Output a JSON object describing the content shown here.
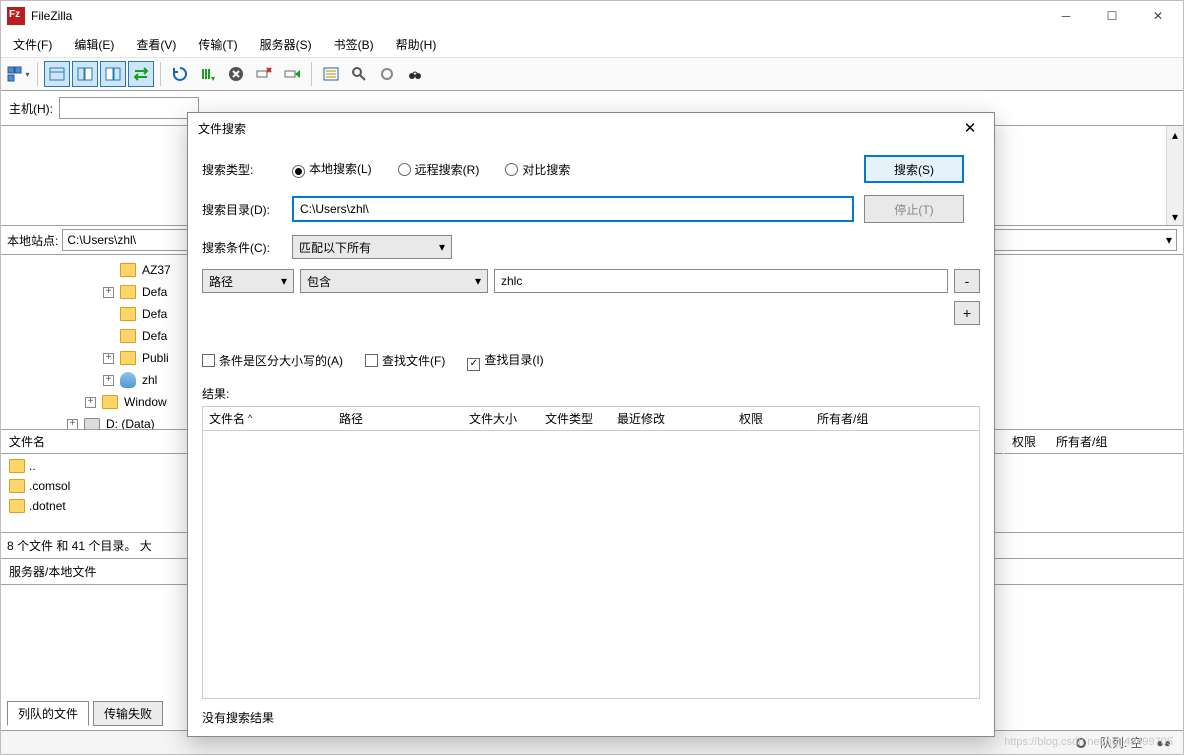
{
  "app": {
    "title": "FileZilla"
  },
  "menu": {
    "file": "文件(F)",
    "edit": "编辑(E)",
    "view": "查看(V)",
    "transfer": "传输(T)",
    "server": "服务器(S)",
    "bookmarks": "书签(B)",
    "help": "帮助(H)"
  },
  "hostbar": {
    "host_label": "主机(H):"
  },
  "local": {
    "site_label": "本地站点:",
    "path": "C:\\Users\\zhl\\",
    "tree": [
      "AZ37",
      "Defa",
      "Defa",
      "Defa",
      "Publi",
      "zhl",
      "Window",
      "D: (Data)"
    ]
  },
  "file_header": {
    "name": "文件名"
  },
  "files": [
    "..",
    ".comsol",
    ".dotnet"
  ],
  "status_line": "8 个文件 和 41 个目录。 大",
  "queue_head": "服务器/本地文件",
  "tabs": {
    "queued": "列队的文件",
    "failed": "传输失败"
  },
  "right_header": {
    "perm": "权限",
    "owner": "所有者/组"
  },
  "statusbar": {
    "queue": "队列: 空"
  },
  "watermark": "https://blog.csdn.net/qq_43499705",
  "dialog": {
    "title": "文件搜索",
    "type_label": "搜索类型:",
    "type_local": "本地搜索(L)",
    "type_remote": "远程搜索(R)",
    "type_compare": "对比搜索",
    "search_btn": "搜索(S)",
    "stop_btn": "停止(T)",
    "dir_label": "搜索目录(D):",
    "dir_value": "C:\\Users\\zhl\\",
    "cond_label": "搜索条件(C):",
    "cond_match": "匹配以下所有",
    "crit_path": "路径",
    "crit_contains": "包含",
    "crit_value": "zhlc",
    "chk_case": "条件是区分大小写的(A)",
    "chk_files": "查找文件(F)",
    "chk_dirs": "查找目录(I)",
    "results_label": "结果:",
    "cols": {
      "name": "文件名",
      "path": "路径",
      "size": "文件大小",
      "type": "文件类型",
      "modified": "最近修改",
      "perm": "权限",
      "owner": "所有者/组"
    },
    "no_results": "没有搜索结果"
  }
}
